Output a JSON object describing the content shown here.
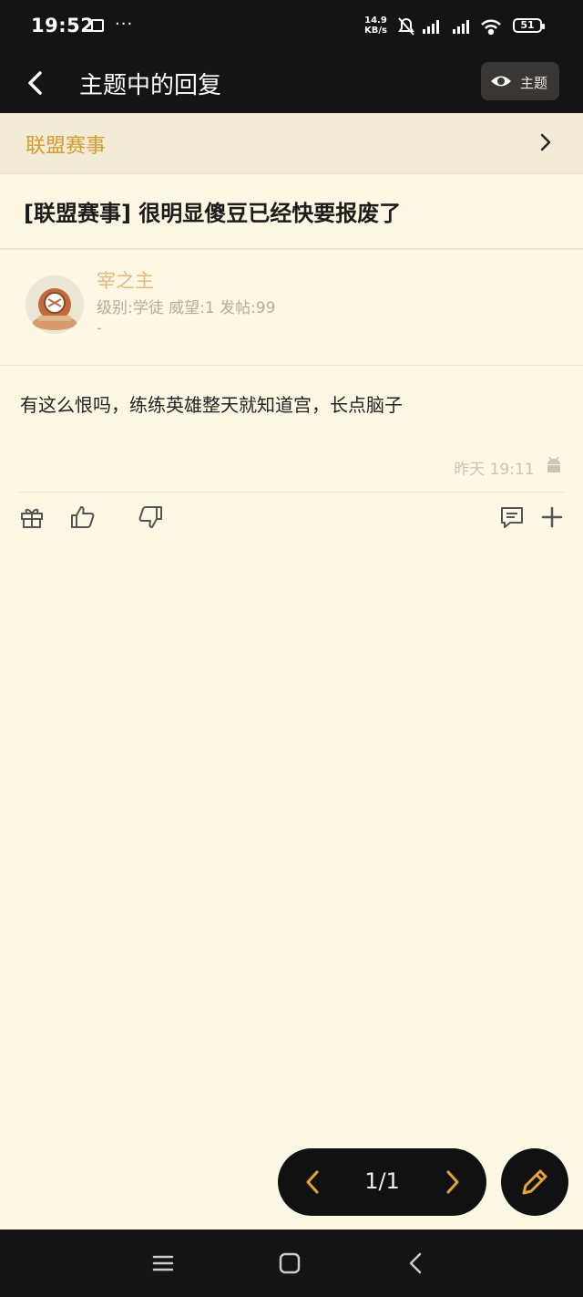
{
  "status_bar": {
    "time": "19:52",
    "more": "···",
    "net_speed_value": "14.9",
    "net_speed_unit": "KB/s",
    "battery": "51"
  },
  "app_bar": {
    "title": "主题中的回复",
    "topic_button_label": "主题"
  },
  "forum": {
    "name": "联盟赛事"
  },
  "topic": {
    "title": "[联盟赛事] 很明显傻豆已经快要报废了"
  },
  "post": {
    "author": "宰之主",
    "stats": "级别:学徒 威望:1 发帖:99",
    "signature": "-",
    "content": "有这么恨吗，练练英雄整天就知道宫，长点脑子",
    "time": "昨天 19:11"
  },
  "pager": {
    "page_text": "1/1"
  },
  "colors": {
    "accent": "#d89a2e",
    "background": "#fdf8e3",
    "dark": "#141414",
    "username": "#e9b878"
  }
}
